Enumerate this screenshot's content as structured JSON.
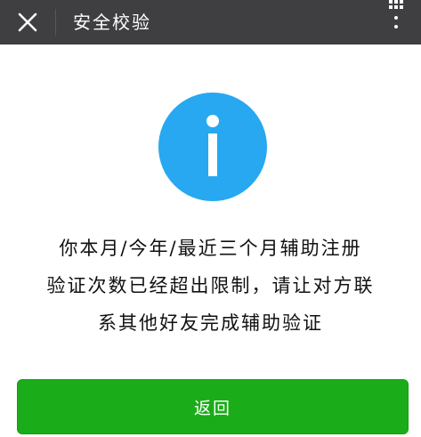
{
  "header": {
    "title": "安全校验",
    "close_icon": "close-icon",
    "menu_icon": "more-options-icon",
    "background_color": "#3f3f42"
  },
  "notice": {
    "icon": "info-icon",
    "icon_color": "#27a8f0",
    "lines": [
      "你本月/今年/最近三个月辅助注册",
      "验证次数已经超出限制，请让对方联",
      "系其他好友完成辅助验证"
    ]
  },
  "actions": {
    "back_label": "返回",
    "back_color": "#1aad19"
  }
}
